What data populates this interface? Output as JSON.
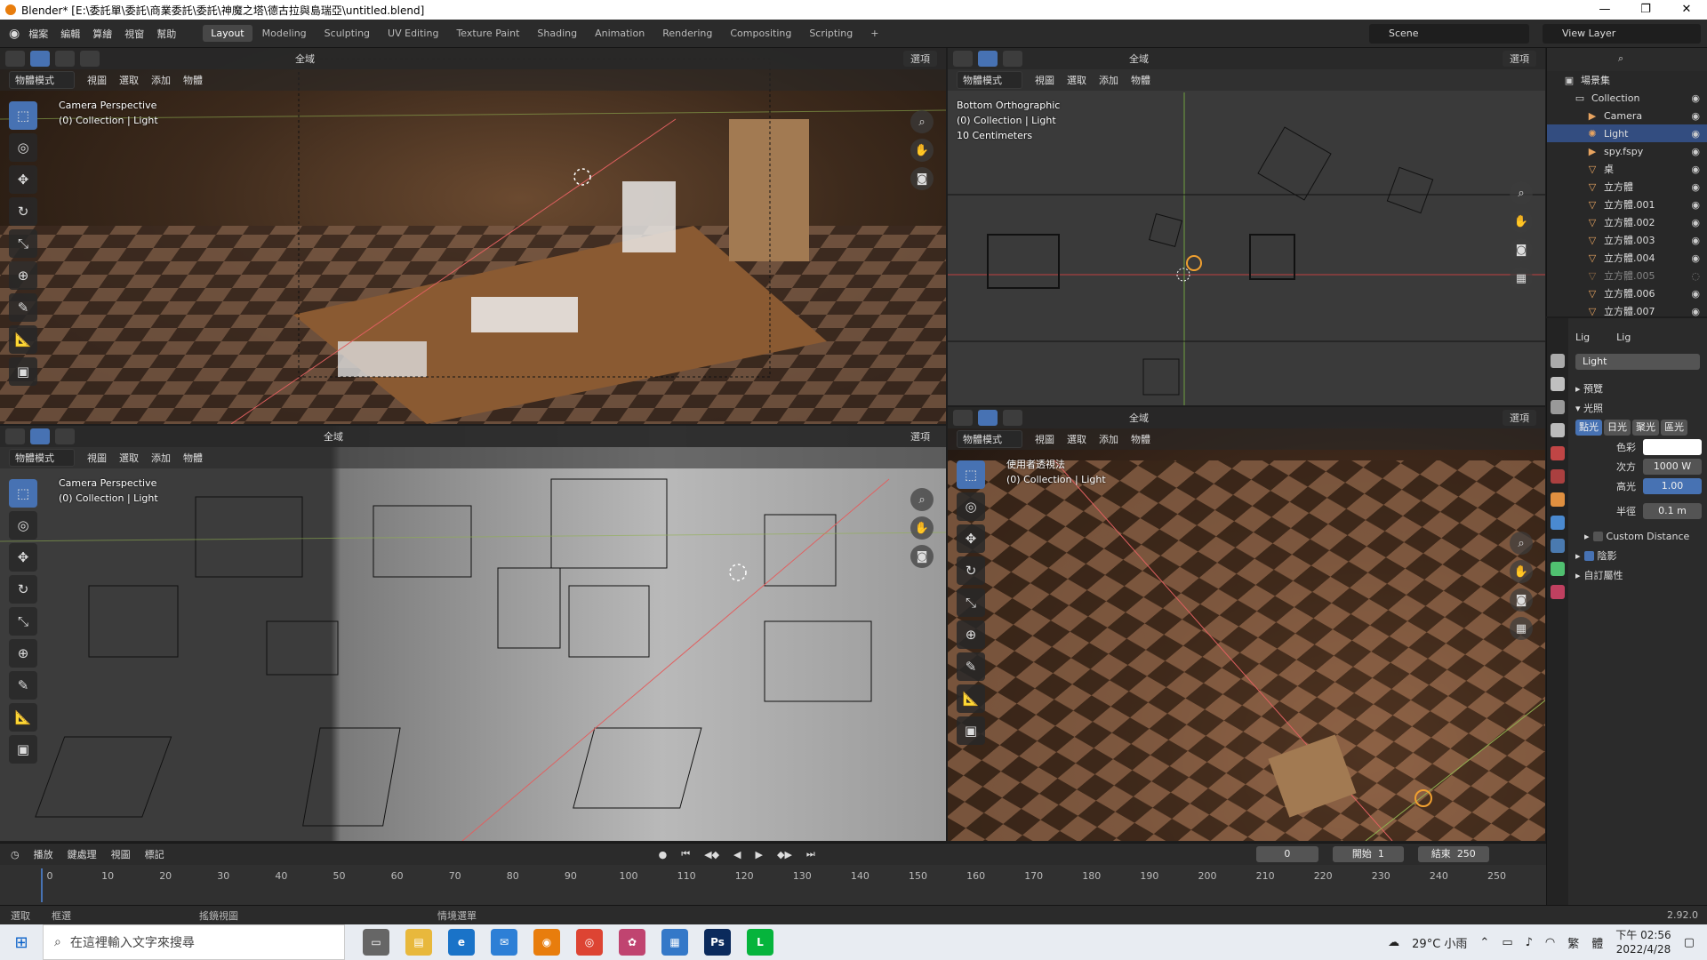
{
  "window": {
    "title": "Blender* [E:\\委託單\\委託\\商業委託\\委託\\神魔之塔\\德古拉與島瑞亞\\untitled.blend]",
    "minimize": "—",
    "maximize": "❐",
    "close": "✕"
  },
  "topbar": {
    "menu": [
      "檔案",
      "編輯",
      "算繪",
      "視窗",
      "幫助"
    ],
    "tabs": [
      "Layout",
      "Modeling",
      "Sculpting",
      "UV Editing",
      "Texture Paint",
      "Shading",
      "Animation",
      "Rendering",
      "Compositing",
      "Scripting"
    ],
    "active_tab": "Layout",
    "add_tab": "+",
    "scene": "Scene",
    "view_layer": "View Layer"
  },
  "viewport_common": {
    "mode": "物體模式",
    "menus": [
      "視圖",
      "選取",
      "添加",
      "物體"
    ],
    "global": "全域",
    "options": "選項"
  },
  "viewports": {
    "top_left": {
      "line1": "Camera Perspective",
      "line2": "(0) Collection | Light"
    },
    "top_right": {
      "line1": "Bottom Orthographic",
      "line2": "(0) Collection | Light",
      "line3": "10 Centimeters"
    },
    "bottom_left": {
      "line1": "Camera Perspective",
      "line2": "(0) Collection | Light"
    },
    "bottom_right": {
      "line1": "使用者透視法",
      "line2": "(0) Collection | Light"
    }
  },
  "outliner": {
    "root": "場景集",
    "items": [
      {
        "name": "Collection",
        "icon": "collection-icon"
      },
      {
        "name": "Camera",
        "icon": "camera-icon"
      },
      {
        "name": "Light",
        "icon": "light-icon"
      },
      {
        "name": "spy.fspy",
        "icon": "camera-icon"
      },
      {
        "name": "桌",
        "icon": "mesh-icon"
      },
      {
        "name": "立方體",
        "icon": "mesh-icon"
      },
      {
        "name": "立方體.001",
        "icon": "mesh-icon"
      },
      {
        "name": "立方體.002",
        "icon": "mesh-icon"
      },
      {
        "name": "立方體.003",
        "icon": "mesh-icon"
      },
      {
        "name": "立方體.004",
        "icon": "mesh-icon"
      },
      {
        "name": "立方體.005",
        "icon": "mesh-icon"
      },
      {
        "name": "立方體.006",
        "icon": "mesh-icon"
      },
      {
        "name": "立方體.007",
        "icon": "mesh-icon"
      }
    ],
    "selected": "Light"
  },
  "properties": {
    "breadcrumb_a": "Lig",
    "breadcrumb_b": "Lig",
    "datablock": "Light",
    "preview": "預覽",
    "light_section": "光照",
    "light_types": [
      "點光",
      "日光",
      "聚光",
      "區光"
    ],
    "active_type": "點光",
    "color_label": "色彩",
    "power_label": "次方",
    "power_value": "1000 W",
    "specular_label": "高光",
    "specular_value": "1.00",
    "radius_label": "半徑",
    "radius_value": "0.1 m",
    "custom_distance": "Custom Distance",
    "shadow": "陰影",
    "custom_props": "自訂屬性"
  },
  "timeline": {
    "menus": [
      "播放",
      "鍵處理",
      "視圖",
      "標記"
    ],
    "current_frame": "0",
    "start_label": "開始",
    "start_value": "1",
    "end_label": "結束",
    "end_value": "250",
    "ruler": [
      "0",
      "10",
      "20",
      "30",
      "40",
      "50",
      "60",
      "70",
      "80",
      "90",
      "100",
      "110",
      "120",
      "130",
      "140",
      "150",
      "160",
      "170",
      "180",
      "190",
      "200",
      "210",
      "220",
      "230",
      "240",
      "250"
    ]
  },
  "statusbar": {
    "items": [
      "選取",
      "框選",
      "搖鏡視圖",
      "情境選單"
    ],
    "version": "2.92.0"
  },
  "taskbar": {
    "search_placeholder": "在這裡輸入文字來搜尋",
    "weather": "29°C 小雨",
    "ime": "繁",
    "ime2": "體",
    "time": "下午 02:56",
    "date": "2022/4/28"
  },
  "colors": {
    "accent": "#4772b3",
    "selected_row": "#334d80",
    "blender_orange": "#e87d0d"
  }
}
